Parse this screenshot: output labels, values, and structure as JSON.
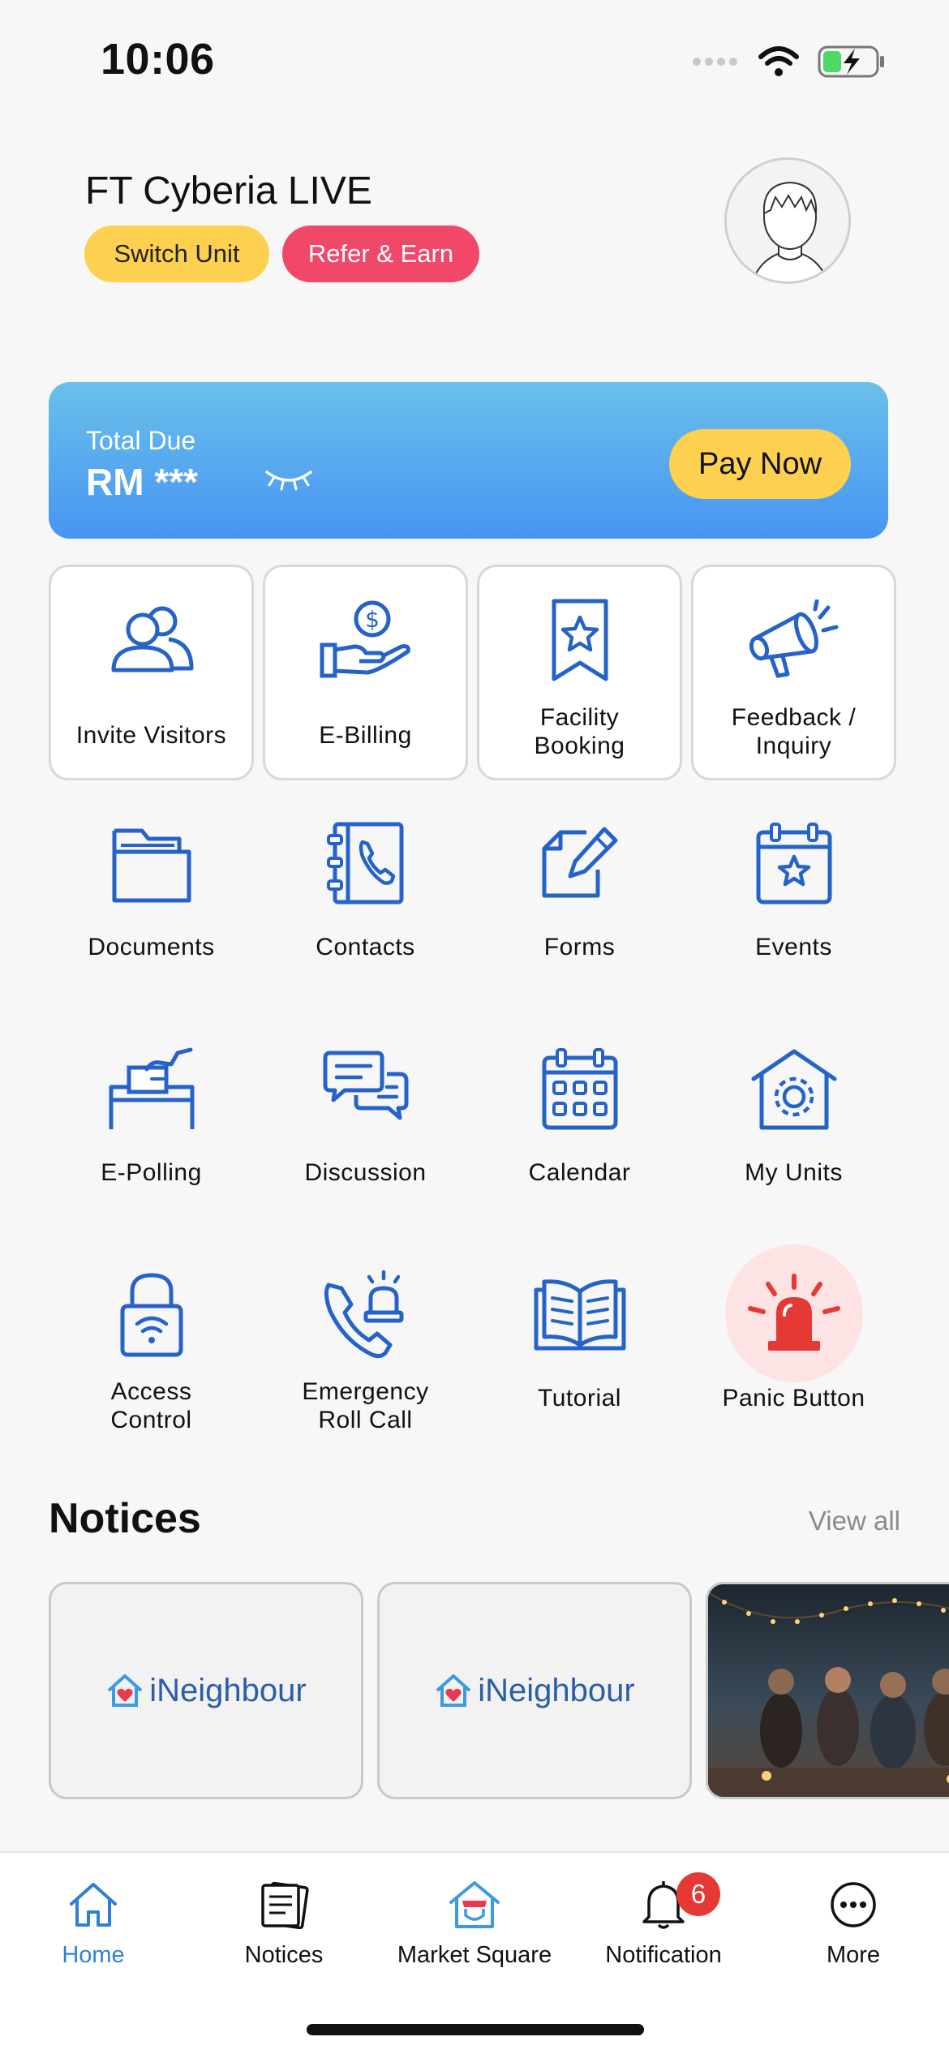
{
  "status": {
    "time": "10:06"
  },
  "header": {
    "title": "FT Cyberia LIVE",
    "switch_unit": "Switch Unit",
    "refer_earn": "Refer & Earn"
  },
  "due": {
    "label": "Total Due",
    "amount": "RM ***",
    "pay_now": "Pay Now"
  },
  "services": {
    "invite_visitors": "Invite Visitors",
    "e_billing": "E-Billing",
    "facility_booking_1": "Facility",
    "facility_booking_2": "Booking",
    "feedback_1": "Feedback /",
    "feedback_2": "Inquiry",
    "documents": "Documents",
    "contacts": "Contacts",
    "forms": "Forms",
    "events": "Events",
    "e_polling": "E-Polling",
    "discussion": "Discussion",
    "calendar": "Calendar",
    "my_units": "My Units",
    "access_control_1": "Access",
    "access_control_2": "Control",
    "emergency_1": "Emergency",
    "emergency_2": "Roll Call",
    "tutorial": "Tutorial",
    "panic_button": "Panic Button"
  },
  "notices": {
    "heading": "Notices",
    "view_all": "View all",
    "brand": "iNeighbour"
  },
  "tabbar": {
    "home": "Home",
    "notices": "Notices",
    "market": "Market Square",
    "notification": "Notification",
    "notification_badge": "6",
    "more": "More"
  },
  "colors": {
    "accent": "#2f7fd6",
    "icon_blue": "#2563c9",
    "yellow": "#fdd14f",
    "pink": "#f1486a",
    "panic_red": "#e53935"
  }
}
